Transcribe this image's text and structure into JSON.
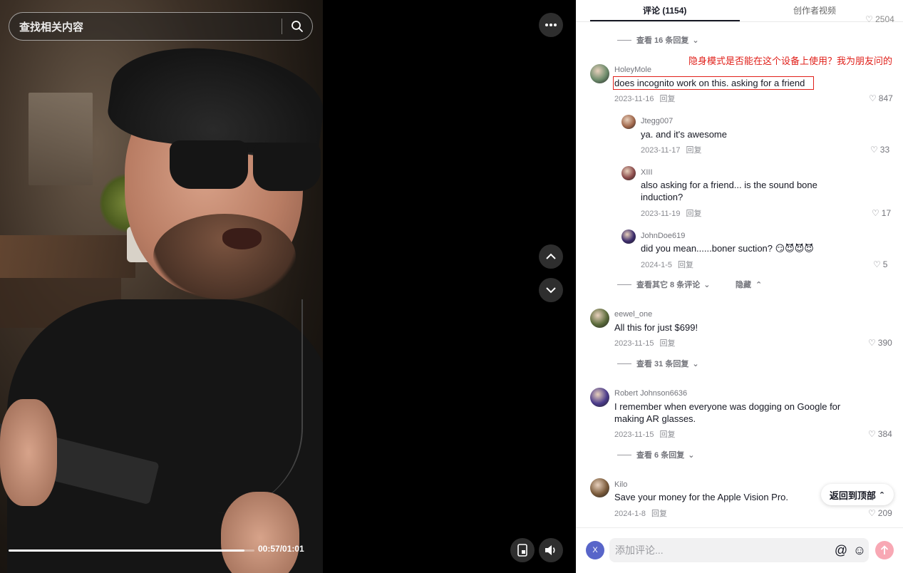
{
  "search": {
    "placeholder": "查找相关内容"
  },
  "player": {
    "timecode": "00:57/01:01",
    "progress_fraction": 0.96
  },
  "tabs": {
    "comments": "评论 (1154)",
    "videos": "创作者视频"
  },
  "peek_like": "♡ 2504",
  "annotation": "隐身模式是否能在这个设备上使用？我为朋友问的",
  "top_viewmore": "查看 16 条回复",
  "comments": [
    {
      "user": "HoleyMole",
      "text": "does incognito work on this. asking for a friend",
      "date": "2023-11-16",
      "reply": "回复",
      "likes": "847",
      "avatar_color": "#6b8a6a"
    },
    {
      "user": "Jtegg007",
      "text": "ya. and it's awesome",
      "date": "2023-11-17",
      "reply": "回复",
      "likes": "33",
      "avatar_color": "#a0674b"
    },
    {
      "user": "XIII",
      "text": "also asking for a friend... is the sound bone induction?",
      "date": "2023-11-19",
      "reply": "回复",
      "likes": "17",
      "avatar_color": "#8a4a4a"
    },
    {
      "user": "JohnDoe619",
      "text": "did you mean......boner suction? 😏😈😈😈",
      "date": "2024-1-5",
      "reply": "回复",
      "likes": "5",
      "avatar_color": "#3a2a6a"
    },
    {
      "user": "eewel_one",
      "text": "All this for just $699!",
      "date": "2023-11-15",
      "reply": "回复",
      "likes": "390",
      "avatar_color": "#5a6a3a"
    },
    {
      "user": "Robert Johnson6636",
      "text": "I remember when everyone was dogging on Google for making AR glasses.",
      "date": "2023-11-15",
      "reply": "回复",
      "likes": "384",
      "avatar_color": "#4a3a8a"
    },
    {
      "user": "Kilo",
      "text": "Save your money for the Apple Vision Pro.",
      "date": "2024-1-8",
      "reply": "回复",
      "likes": "209",
      "avatar_color": "#7a5a3a"
    }
  ],
  "replies_footer": {
    "more": "查看其它 8 条评论",
    "hide": "隐藏"
  },
  "viewmore_31": "查看 31 条回复",
  "viewmore_6": "查看 6 条回复",
  "back_top": "返回到顶部",
  "composer": {
    "avatar_letter": "X",
    "placeholder": "添加评论..."
  }
}
